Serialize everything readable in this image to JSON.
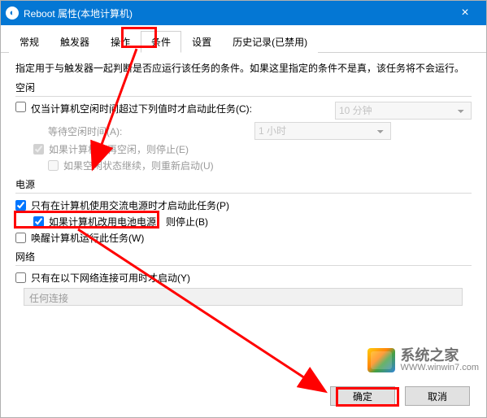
{
  "title": "Reboot 属性(本地计算机)",
  "close_glyph": "×",
  "tabs": [
    {
      "label": "常规"
    },
    {
      "label": "触发器"
    },
    {
      "label": "操作"
    },
    {
      "label": "条件",
      "active": true
    },
    {
      "label": "设置"
    },
    {
      "label": "历史记录(已禁用)"
    }
  ],
  "description": "指定用于与触发器一起判断是否应运行该任务的条件。如果这里指定的条件不是真，该任务将不会运行。",
  "idle": {
    "title": "空闲",
    "only_when_idle": "仅当计算机空闲时间超过下列值时才启动此任务(C):",
    "wait_idle": "等待空闲时间(A):",
    "stop_if_not_idle": "如果计算机不再空闲，则停止(E)",
    "restart_on_idle": "如果空闲状态继续，则重新启动(U)",
    "dur1": "10 分钟",
    "dur2": "1 小时"
  },
  "power": {
    "title": "电源",
    "only_on_ac": "只有在计算机使用交流电源时才启动此任务(P)",
    "stop_on_battery": "如果计算机改用电池电源，则停止(B)",
    "wake": "唤醒计算机运行此任务(W)"
  },
  "network": {
    "title": "网络",
    "only_on_net": "只有在以下网络连接可用时才启动(Y)",
    "any": "任何连接"
  },
  "buttons": {
    "ok": "确定",
    "cancel": "取消"
  },
  "watermark": {
    "brand": "系统之家",
    "url": "WWW.winwin7.com"
  }
}
